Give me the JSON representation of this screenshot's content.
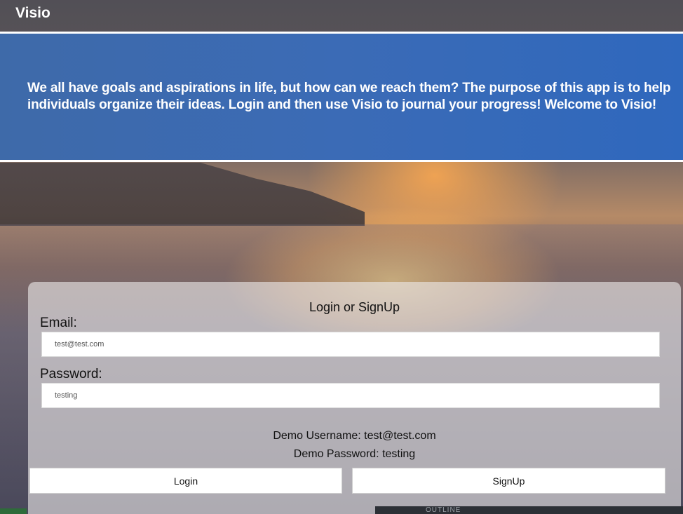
{
  "header": {
    "brand": "Visio"
  },
  "banner": {
    "text": "We all have goals and aspirations in life, but how can we reach them? The purpose of this app is to help individuals organize their ideas. Login and then use Visio to journal your progress! Welcome to Visio!"
  },
  "login": {
    "title": "Login or SignUp",
    "email_label": "Email:",
    "email_value": "test@test.com",
    "password_label": "Password:",
    "password_value": "testing",
    "demo_username": "Demo Username: test@test.com",
    "demo_password": "Demo Password: testing",
    "login_button": "Login",
    "signup_button": "SignUp"
  },
  "footer": {
    "partial_text": "OUTLINE"
  }
}
